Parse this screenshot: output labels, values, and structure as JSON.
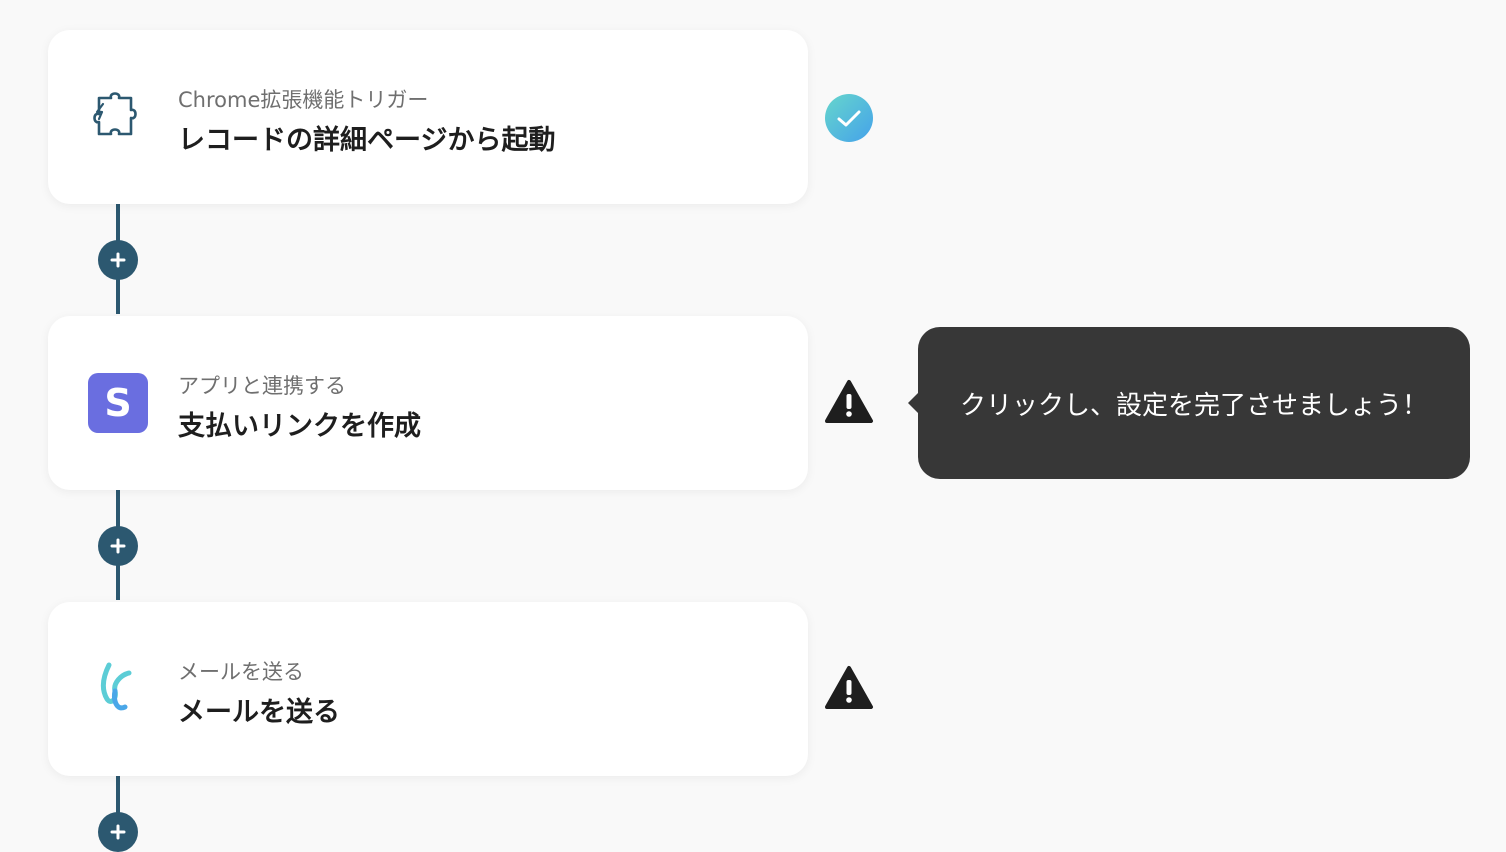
{
  "steps": [
    {
      "kind": "Chrome拡張機能トリガー",
      "title": "レコードの詳細ページから起動",
      "icon": "puzzle-piece-icon",
      "status": "complete",
      "status_icon": "checkmark-icon"
    },
    {
      "kind": "アプリと連携する",
      "title": "支払いリンクを作成",
      "icon": "stripe-logo-icon",
      "icon_letter": "S",
      "status": "warning",
      "status_icon": "warning-icon"
    },
    {
      "kind": "メールを送る",
      "title": "メールを送る",
      "icon": "mail-logo-icon",
      "status": "warning",
      "status_icon": "warning-icon"
    }
  ],
  "tooltip": {
    "text": "クリックし、設定を完了させましょう！"
  },
  "colors": {
    "background": "#f9f9f9",
    "connector": "#2c5870",
    "card": "#ffffff",
    "tooltip_bg": "#373737",
    "stripe": "#6a6ee0",
    "check_gradient_start": "#5ecdd8",
    "check_gradient_end": "#4aa7e8",
    "warning": "#1e1e1e"
  }
}
